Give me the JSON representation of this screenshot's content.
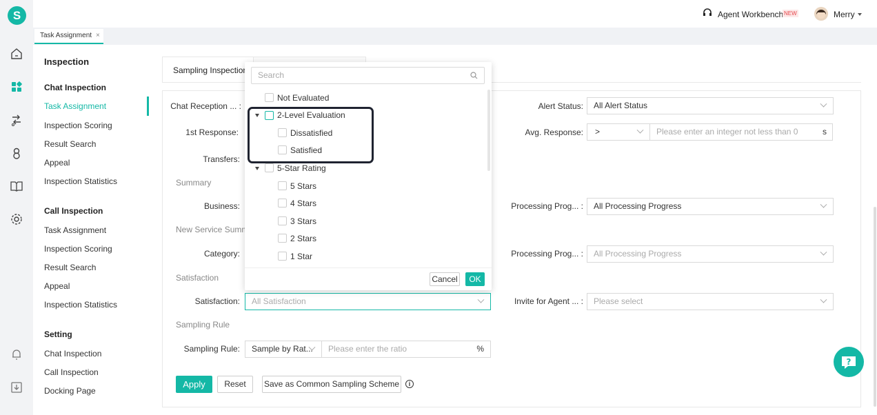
{
  "app": {
    "logo": "S"
  },
  "header": {
    "workbench": "Agent Workbench",
    "new_badge": "NEW",
    "user": "Merry"
  },
  "tabs": [
    {
      "label": "Task Assignment",
      "close": "×"
    }
  ],
  "sidebar": {
    "title": "Inspection",
    "chat_group": "Chat Inspection",
    "chat_items": [
      "Task Assignment",
      "Inspection Scoring",
      "Result Search",
      "Appeal",
      "Inspection Statistics"
    ],
    "call_group": "Call Inspection",
    "call_items": [
      "Task Assignment",
      "Inspection Scoring",
      "Result Search",
      "Appeal",
      "Inspection Statistics"
    ],
    "setting_group": "Setting",
    "setting_items": [
      "Chat Inspection",
      "Call Inspection",
      "Docking Page"
    ]
  },
  "page": {
    "tab": "Sampling Inspection"
  },
  "form": {
    "chat_reception": "Chat Reception ... :",
    "first_response": "1st Response:",
    "transfers": "Transfers:",
    "summary": "Summary",
    "business": "Business:",
    "new_service": "New Service Summa",
    "category": "Category:",
    "satisfaction_sec": "Satisfaction",
    "satisfaction": "Satisfaction:",
    "satisfaction_ph": "All Satisfaction",
    "sampling_sec": "Sampling Rule",
    "sampling_rule": "Sampling Rule:",
    "sampling_mode": "Sample by Rat...",
    "ratio_ph": "Please enter the ratio",
    "pct": "%",
    "alert_status": "Alert Status:",
    "alert_value": "All Alert Status",
    "avg_response": "Avg. Response:",
    "avg_op": ">",
    "avg_ph": "Please enter an integer not less than 0",
    "avg_unit": "s",
    "proc1": "Processing Prog... :",
    "proc1_value": "All Processing Progress",
    "proc2": "Processing Prog... :",
    "proc2_ph": "All Processing Progress",
    "invite": "Invite for Agent ... :",
    "invite_ph": "Please select"
  },
  "buttons": {
    "apply": "Apply",
    "reset": "Reset",
    "save_scheme": "Save as Common Sampling Scheme"
  },
  "dropdown": {
    "search_ph": "Search",
    "not_evaluated": "Not Evaluated",
    "two_level": "2-Level Evaluation",
    "dissatisfied": "Dissatisfied",
    "satisfied": "Satisfied",
    "five_star": "5-Star Rating",
    "stars": [
      "5 Stars",
      "4 Stars",
      "3 Stars",
      "2 Stars",
      "1 Star"
    ],
    "cancel": "Cancel",
    "ok": "OK"
  },
  "colors": {
    "accent": "#14b8a6",
    "highlight_box": "#1f2330"
  }
}
